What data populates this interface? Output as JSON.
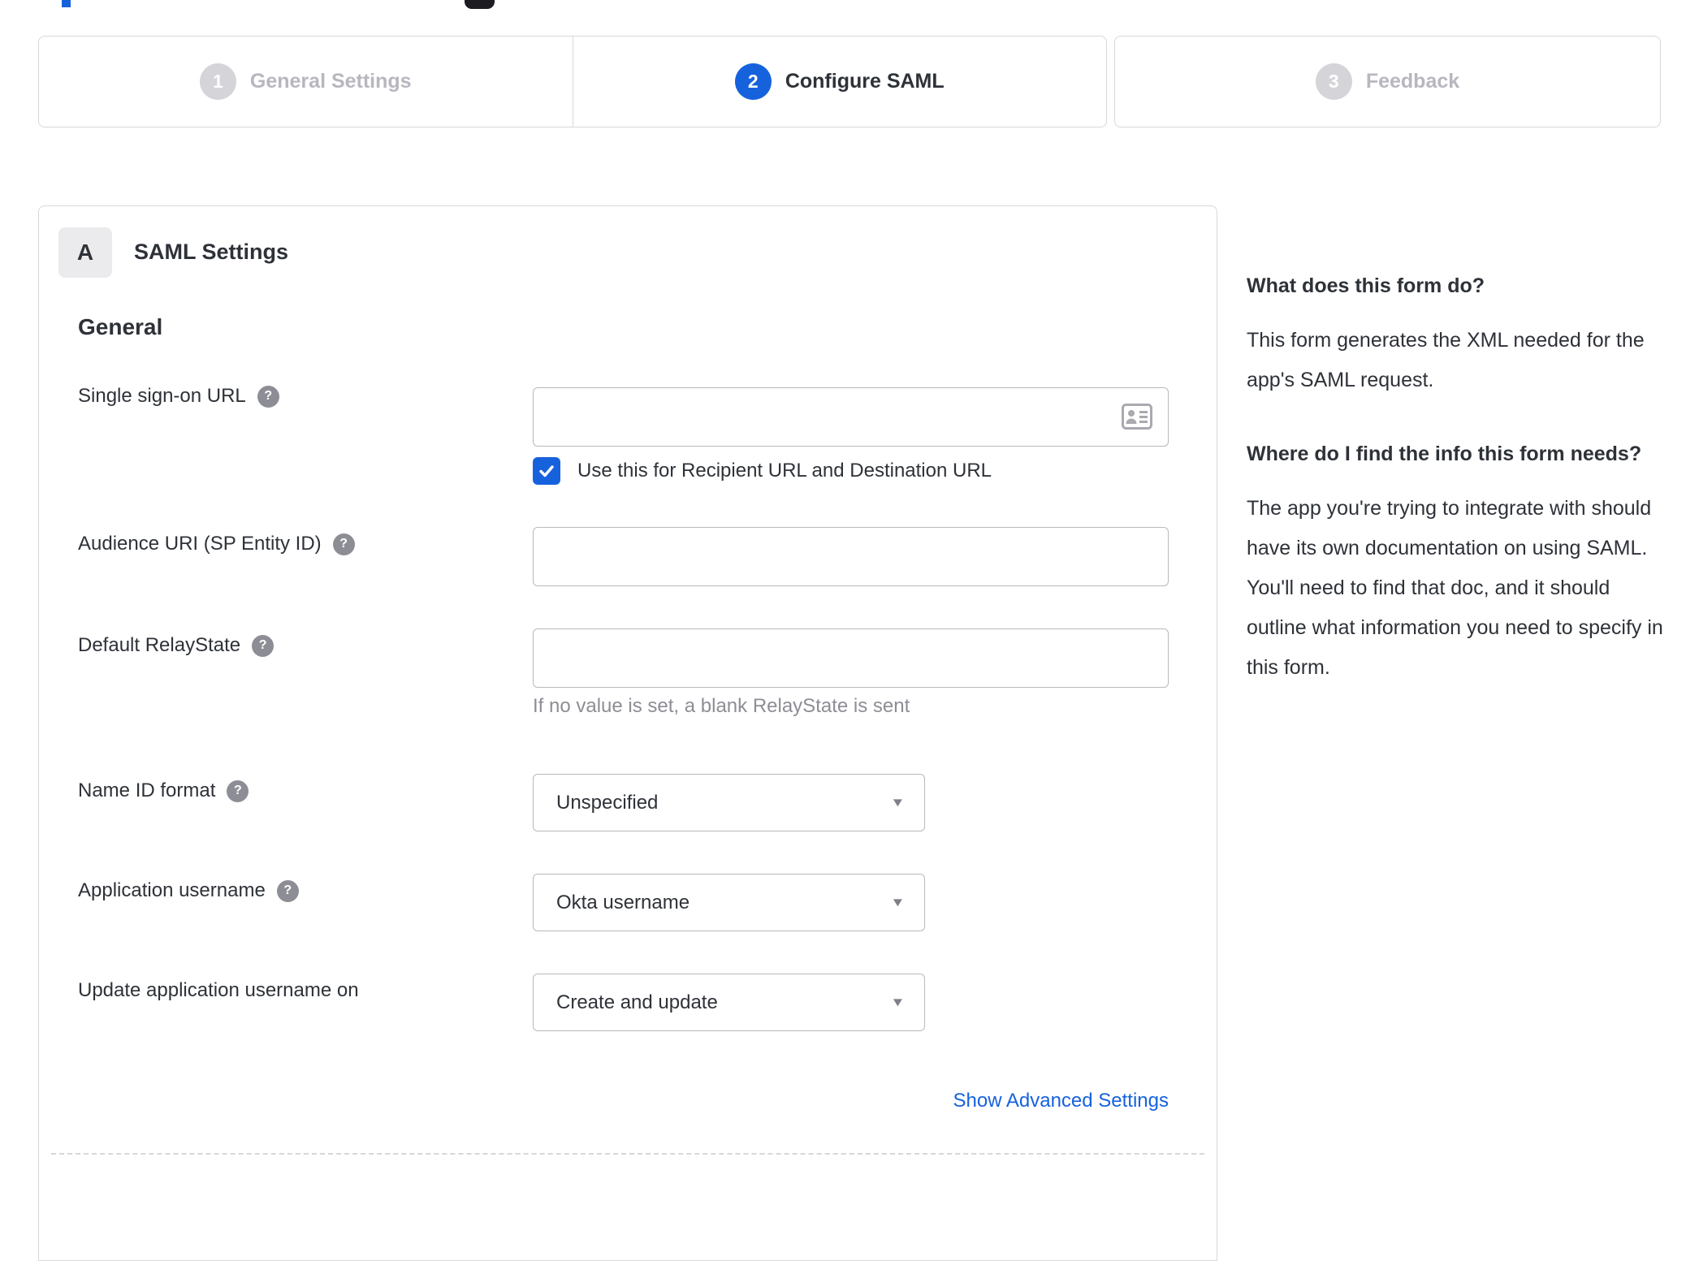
{
  "colors": {
    "accent_blue": "#1662dd",
    "inactive_gray": "#d4d4d9",
    "border_gray": "#d8d8dc",
    "input_border": "#b9b9bf",
    "muted_text": "#8d8d95",
    "body_text": "#2e3238"
  },
  "stepper": {
    "steps": [
      {
        "number": "1",
        "label": "General Settings",
        "state": "inactive"
      },
      {
        "number": "2",
        "label": "Configure SAML",
        "state": "active"
      },
      {
        "number": "3",
        "label": "Feedback",
        "state": "inactive"
      }
    ]
  },
  "form": {
    "section_badge": "A",
    "section_title": "SAML Settings",
    "group_title": "General",
    "fields": {
      "sso": {
        "label": "Single sign-on URL",
        "value": "",
        "checkbox_label": "Use this for Recipient URL and Destination URL",
        "checkbox_checked": true
      },
      "audience": {
        "label": "Audience URI (SP Entity ID)",
        "value": ""
      },
      "relay": {
        "label": "Default RelayState",
        "value": "",
        "helper": "If no value is set, a blank RelayState is sent"
      },
      "name_id": {
        "label": "Name ID format",
        "value": "Unspecified"
      },
      "app_username": {
        "label": "Application username",
        "value": "Okta username"
      },
      "update_username": {
        "label": "Update application username on",
        "value": "Create and update"
      }
    },
    "advanced_link": "Show Advanced Settings"
  },
  "sidebar": {
    "question_1": "What does this form do?",
    "answer_1": "This form generates the XML needed for the app's SAML request.",
    "question_2": "Where do I find the info this form needs?",
    "answer_2": "The app you're trying to integrate with should have its own documentation on using SAML. You'll need to find that doc, and it should outline what information you need to specify in this form."
  },
  "icons": {
    "help": "?",
    "dropdown_caret": "▼"
  }
}
